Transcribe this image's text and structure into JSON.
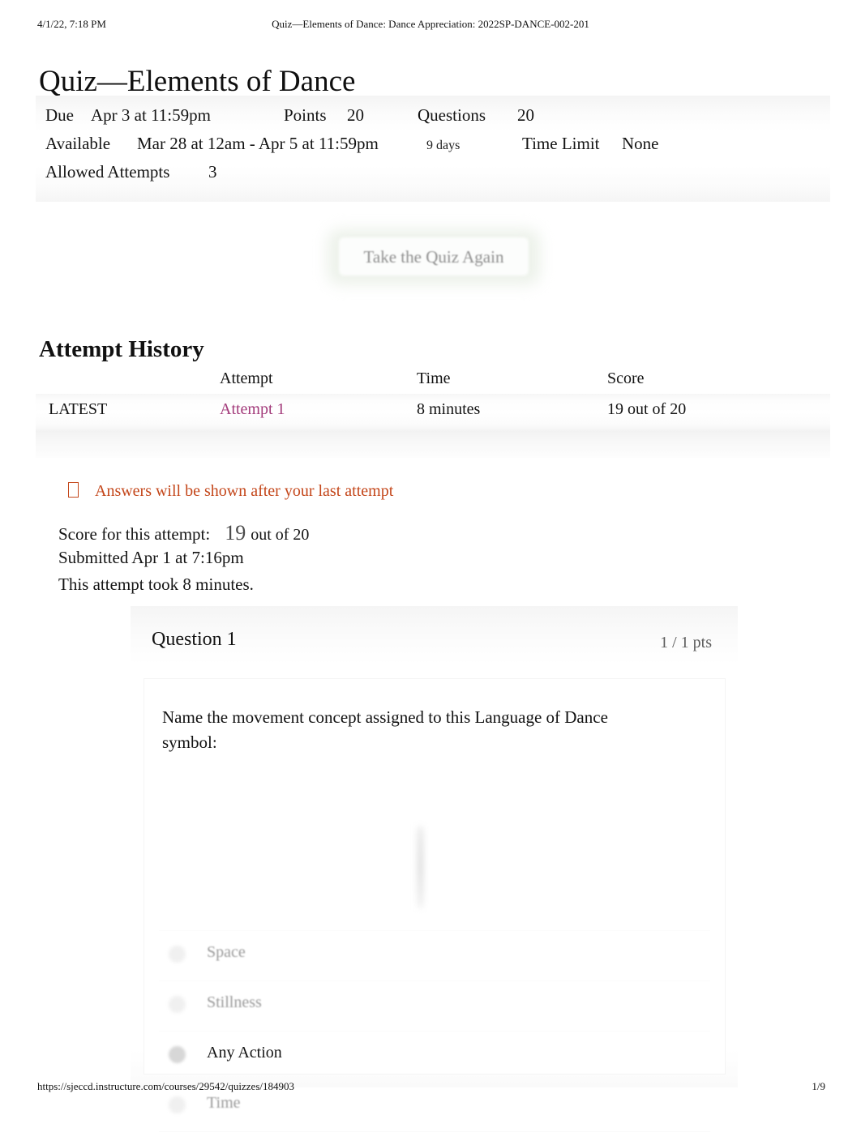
{
  "print_header": {
    "date": "4/1/22, 7:18 PM",
    "title": "Quiz—Elements of Dance: Dance Appreciation: 2022SP-DANCE-002-201"
  },
  "page_title": "Quiz—Elements of Dance",
  "quiz_meta": {
    "due_label": "Due",
    "due_value": "Apr 3 at 11:59pm",
    "points_label": "Points",
    "points_value": "20",
    "questions_label": "Questions",
    "questions_value": "20",
    "available_label": "Available",
    "available_value": "Mar 28 at 12am - Apr 5 at 11:59pm",
    "available_duration": "9 days",
    "time_limit_label": "Time Limit",
    "time_limit_value": "None",
    "allowed_attempts_label": "Allowed Attempts",
    "allowed_attempts_value": "3"
  },
  "retake_button": {
    "label": "Take the Quiz Again"
  },
  "attempt_history": {
    "heading": "Attempt History",
    "columns": [
      "",
      "Attempt",
      "Time",
      "Score"
    ],
    "rows": [
      {
        "marker": "LATEST",
        "attempt": "Attempt 1",
        "time": "8 minutes",
        "score": "19 out of 20"
      }
    ]
  },
  "answers_notice": {
    "text": "Answers will be shown after your last attempt",
    "icon": "warning-box-icon",
    "color": "#c4471b"
  },
  "score_summary": {
    "score_label": "Score for this attempt:",
    "score_value": "19",
    "score_out_of": "out of 20",
    "submitted": "Submitted Apr 1 at 7:16pm",
    "duration": "This attempt took 8 minutes."
  },
  "question": {
    "title": "Question 1",
    "points": "1 / 1 pts",
    "text": "Name the movement concept assigned to this Language of Dance symbol:",
    "symbol": "language-of-dance-symbol-image",
    "options": [
      {
        "label": "Space",
        "selected": false
      },
      {
        "label": "Stillness",
        "selected": false
      },
      {
        "label": "Any Action",
        "selected": true
      },
      {
        "label": "Time",
        "selected": false
      }
    ]
  },
  "print_footer": {
    "url": "https://sjeccd.instructure.com/courses/29542/quizzes/184903",
    "page": "1/9"
  }
}
